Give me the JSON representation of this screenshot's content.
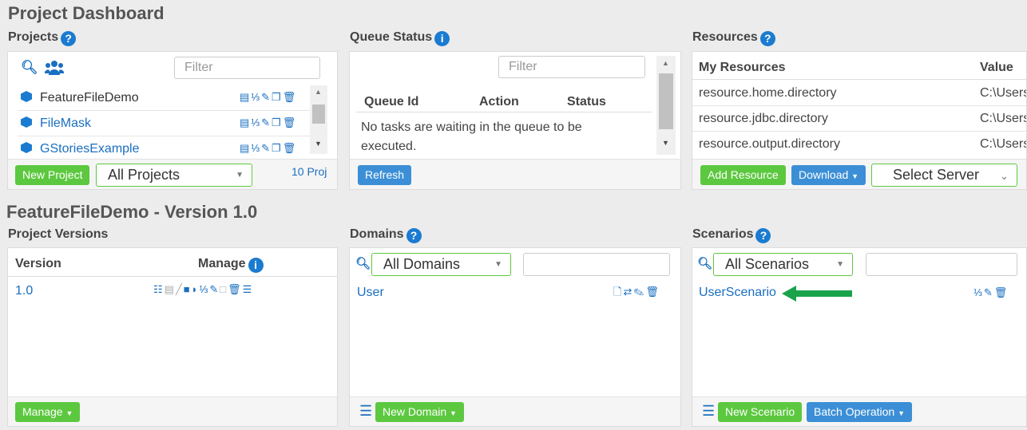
{
  "page_title": "Project Dashboard",
  "projects": {
    "title": "Projects",
    "filter_placeholder": "Filter",
    "items": [
      {
        "name": "FeatureFileDemo"
      },
      {
        "name": "FileMask"
      },
      {
        "name": "GStoriesExample"
      }
    ],
    "new_project_label": "New Project",
    "scope_select": "All Projects",
    "count_text": "10 Proj"
  },
  "queue": {
    "title": "Queue Status",
    "filter_placeholder": "Filter",
    "columns": [
      "Queue Id",
      "Action",
      "Status"
    ],
    "empty_message": "No tasks are waiting in the queue to be executed.",
    "refresh_label": "Refresh"
  },
  "resources": {
    "title": "Resources",
    "columns": [
      "My Resources",
      "Value"
    ],
    "rows": [
      {
        "name": "resource.home.directory",
        "value": "C:\\Users"
      },
      {
        "name": "resource.jdbc.directory",
        "value": "C:\\Users"
      },
      {
        "name": "resource.output.directory",
        "value": "C:\\Users"
      }
    ],
    "add_label": "Add Resource",
    "download_label": "Download",
    "server_select": "Select Server"
  },
  "project_header": "FeatureFileDemo - Version 1.0",
  "versions": {
    "title": "Project Versions",
    "columns": [
      "Version",
      "Manage"
    ],
    "rows": [
      {
        "version": "1.0"
      }
    ],
    "manage_label": "Manage"
  },
  "domains": {
    "title": "Domains",
    "select": "All Domains",
    "items": [
      {
        "name": "User"
      }
    ],
    "new_label": "New Domain"
  },
  "scenarios": {
    "title": "Scenarios",
    "select": "All Scenarios",
    "items": [
      {
        "name": "UserScenario"
      }
    ],
    "new_label": "New Scenario",
    "batch_label": "Batch Operation"
  },
  "colors": {
    "primary_blue": "#1a7bd0",
    "button_green": "#5cc83f",
    "button_blue": "#3c8fd6",
    "arrow_green": "#1aa34a"
  }
}
